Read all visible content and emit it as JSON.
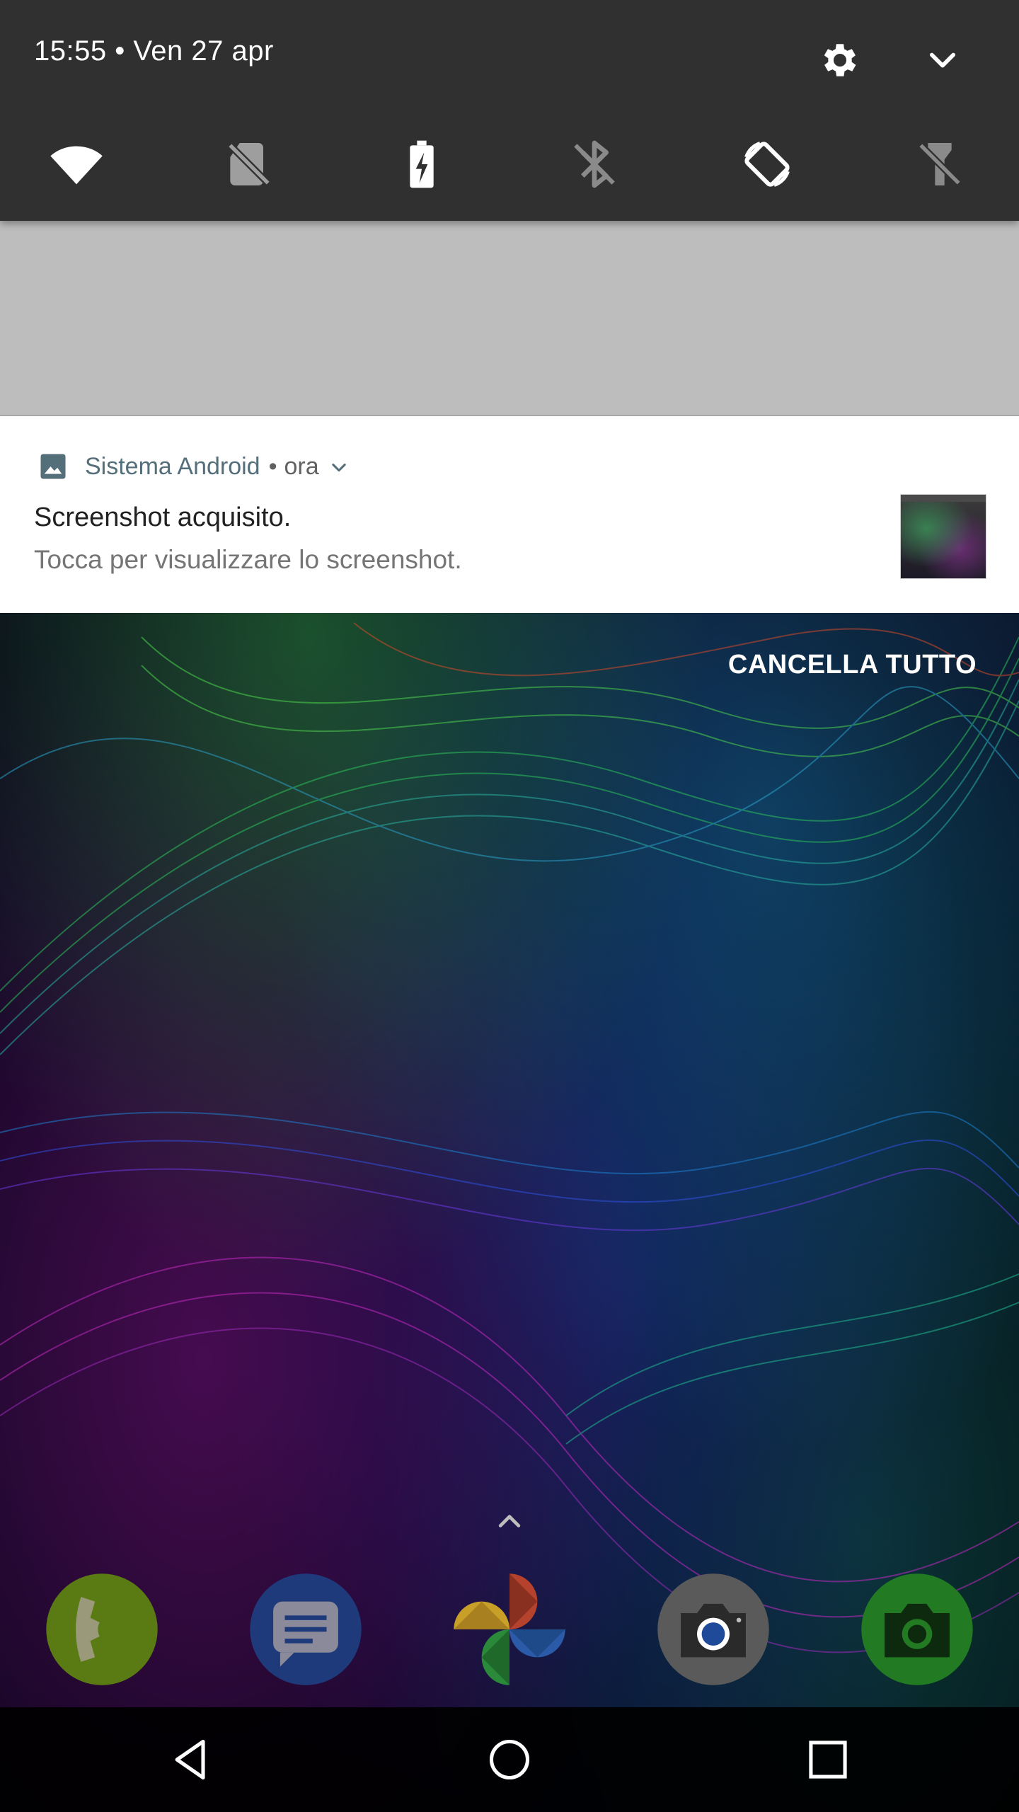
{
  "status": {
    "time_date": "15:55 • Ven 27 apr"
  },
  "quick_settings": {
    "tiles": [
      "wifi-icon",
      "no-sim-icon",
      "battery-saver-icon",
      "bluetooth-off-icon",
      "auto-rotate-icon",
      "flashlight-off-icon"
    ]
  },
  "notification": {
    "app_name": "Sistema Android",
    "separator": "•",
    "time": "ora",
    "title": "Screenshot acquisito.",
    "text": "Tocca per visualizzare lo screenshot."
  },
  "clear_all_label": "CANCELLA TUTTO",
  "dock": {
    "apps": [
      "phone-icon",
      "messages-icon",
      "photos-icon",
      "camera-icon",
      "camera-green-icon"
    ]
  },
  "navigation": {
    "buttons": [
      "back-icon",
      "home-icon",
      "recents-icon"
    ]
  },
  "colors": {
    "panel_bg": "#303030",
    "scrim_bg": "#bdbdbd",
    "notification_bg": "#ffffff",
    "app_name_color": "#546e7a"
  }
}
